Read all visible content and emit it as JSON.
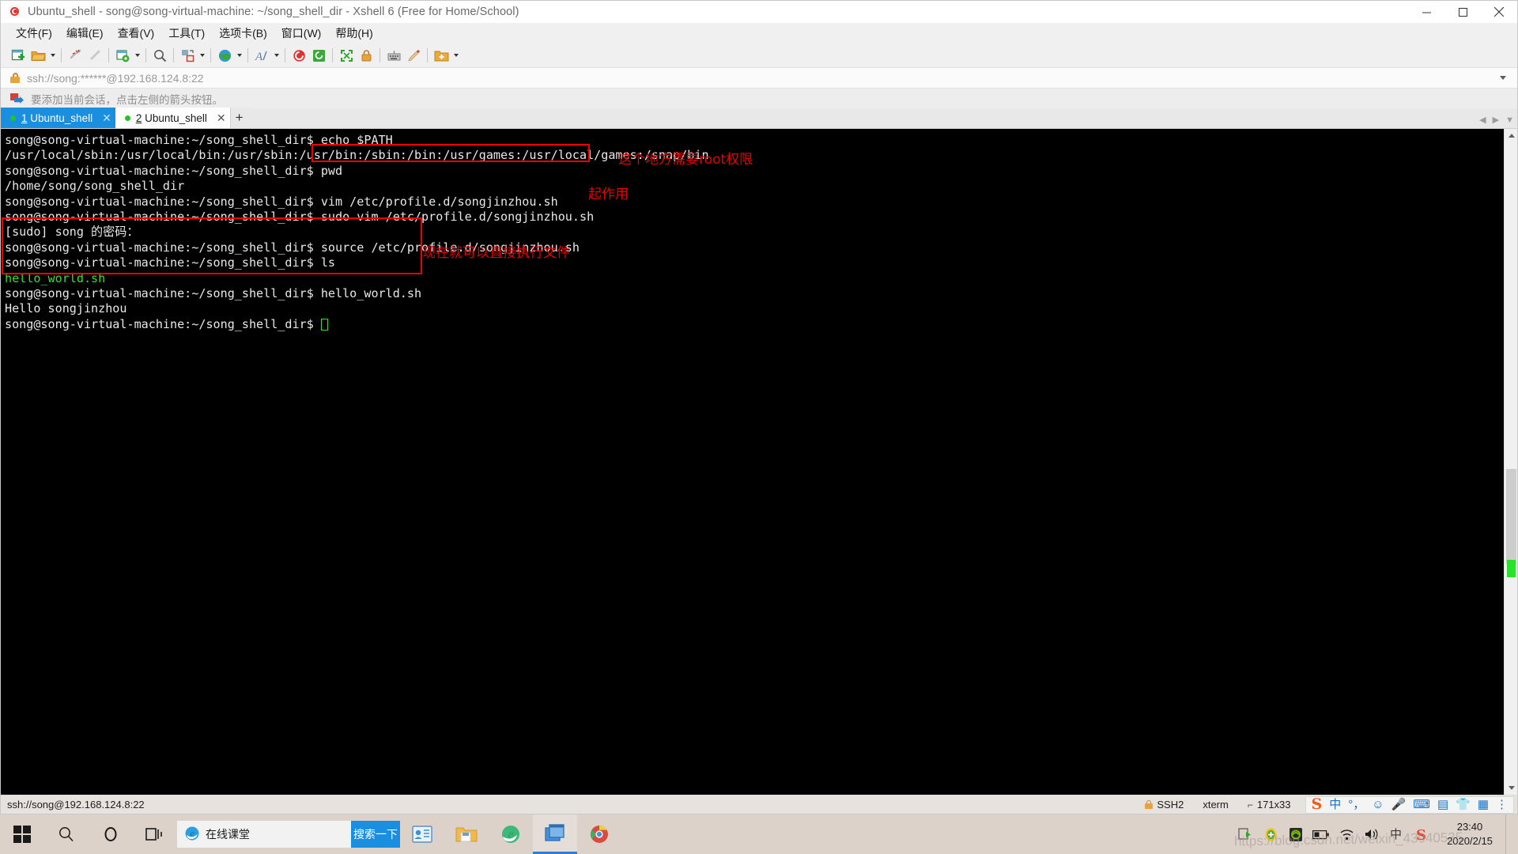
{
  "window": {
    "title": "Ubuntu_shell - song@song-virtual-machine: ~/song_shell_dir - Xshell 6 (Free for Home/School)",
    "app_icon": "xshell-icon",
    "minimize_label": "Minimize",
    "maximize_label": "Maximize",
    "close_label": "Close"
  },
  "menubar": {
    "items": [
      {
        "label": "文件(F)",
        "name": "menu-file"
      },
      {
        "label": "编辑(E)",
        "name": "menu-edit"
      },
      {
        "label": "查看(V)",
        "name": "menu-view"
      },
      {
        "label": "工具(T)",
        "name": "menu-tools"
      },
      {
        "label": "选项卡(B)",
        "name": "menu-tabs"
      },
      {
        "label": "窗口(W)",
        "name": "menu-window"
      },
      {
        "label": "帮助(H)",
        "name": "menu-help"
      }
    ]
  },
  "toolbar": {
    "buttons": [
      {
        "icon": "new-session-icon",
        "caret": false
      },
      {
        "icon": "open-folder-icon",
        "caret": true
      },
      {
        "icon": "disconnect-icon",
        "caret": false
      },
      {
        "icon": "reconnect-link-icon",
        "caret": false
      },
      {
        "icon": "session-properties-icon",
        "caret": true
      },
      {
        "icon": "find-icon",
        "caret": false
      },
      {
        "icon": "file-transfer-icon",
        "caret": true
      },
      {
        "icon": "globe-icon",
        "caret": true
      },
      {
        "icon": "font-icon",
        "caret": true
      },
      {
        "icon": "xshell-red-icon",
        "caret": false
      },
      {
        "icon": "xftp-green-icon",
        "caret": false
      },
      {
        "icon": "fullscreen-icon",
        "caret": false
      },
      {
        "icon": "lock-icon",
        "caret": false
      },
      {
        "icon": "keyboard-icon",
        "caret": false
      },
      {
        "icon": "highlight-pen-icon",
        "caret": false
      },
      {
        "icon": "add-folder-icon",
        "caret": true
      }
    ]
  },
  "urlbar": {
    "icon": "lock-icon",
    "value": "ssh://song:******@192.168.124.8:22",
    "dropdown_icon": "chevron-down-icon"
  },
  "notice": {
    "icon": "add-session-arrow-icon",
    "text": "要添加当前会话，点击左侧的箭头按钮。"
  },
  "tabs": {
    "items": [
      {
        "num": "1",
        "label": " Ubuntu_shell",
        "active": true,
        "close_icon": "close-icon"
      },
      {
        "num": "2",
        "label": " Ubuntu_shell",
        "active": false,
        "close_icon": "close-icon"
      }
    ],
    "new_tab_label": "+",
    "scroll_left_icon": "chevron-left-icon",
    "scroll_right_icon": "chevron-right-icon",
    "menu_icon": "chevron-down-icon"
  },
  "terminal": {
    "prompt": "song@song-virtual-machine:~/song_shell_dir$ ",
    "lines": [
      {
        "type": "plain",
        "text": "song@song-virtual-machine:~/song_shell_dir$ echo $PATH"
      },
      {
        "type": "plain",
        "text": "/usr/local/sbin:/usr/local/bin:/usr/sbin:/usr/bin:/sbin:/bin:/usr/games:/usr/local/games:/snap/bin"
      },
      {
        "type": "plain",
        "text": "song@song-virtual-machine:~/song_shell_dir$ pwd"
      },
      {
        "type": "plain",
        "text": "/home/song/song_shell_dir"
      },
      {
        "type": "plain",
        "text": "song@song-virtual-machine:~/song_shell_dir$ vim /etc/profile.d/songjinzhou.sh"
      },
      {
        "type": "plain",
        "text": "song@song-virtual-machine:~/song_shell_dir$ sudo vim /etc/profile.d/songjinzhou.sh"
      },
      {
        "type": "plain",
        "text": "[sudo] song 的密码："
      },
      {
        "type": "plain",
        "text": "song@song-virtual-machine:~/song_shell_dir$ source /etc/profile.d/songjinzhou.sh"
      },
      {
        "type": "plain",
        "text": "song@song-virtual-machine:~/song_shell_dir$ ls"
      },
      {
        "type": "green",
        "text": "hello_world.sh"
      },
      {
        "type": "plain",
        "text": "song@song-virtual-machine:~/song_shell_dir$ hello_world.sh"
      },
      {
        "type": "plain",
        "text": "Hello songjinzhou"
      },
      {
        "type": "cursor",
        "text": "song@song-virtual-machine:~/song_shell_dir$ "
      }
    ],
    "colors": {
      "background": "#000000",
      "foreground": "#e8e8e8",
      "green": "#2ee02e"
    }
  },
  "annotations": {
    "color": "#e60000",
    "items": [
      {
        "text": "这个地方需要root权限",
        "name": "annotation-root-permission"
      },
      {
        "text": "起作用",
        "name": "annotation-takes-effect"
      },
      {
        "text": "现在就可以直接执行文件",
        "name": "annotation-can-execute-directly"
      }
    ]
  },
  "statusbar": {
    "connection": "ssh://song@192.168.124.8:22",
    "security": "SSH2",
    "terminal_type": "xterm",
    "size_icon": "corner-icon",
    "size": "171x33",
    "ime": {
      "logo": "sogou-logo-icon",
      "lang": "中",
      "punct": "°，",
      "smiley": "smiley-icon",
      "mic": "microphone-icon",
      "keyboard": "keyboard-icon",
      "user": "user-card-icon",
      "shirt": "skin-icon",
      "grid": "toolbox-icon",
      "more": "more-icon"
    }
  },
  "taskbar": {
    "start_icon": "windows-start-icon",
    "search_icon": "search-icon",
    "cortana_icon": "cortana-icon",
    "taskview_icon": "task-view-icon",
    "search_box": {
      "icon": "ie-icon",
      "value": "在线课堂",
      "button_label": "搜索一下"
    },
    "pinned": [
      {
        "icon": "contacts-icon",
        "name": "taskbar-contacts"
      },
      {
        "icon": "file-explorer-icon",
        "name": "taskbar-file-explorer"
      },
      {
        "icon": "edge-icon",
        "name": "taskbar-edge"
      },
      {
        "icon": "xshell-window-icon",
        "name": "taskbar-xshell",
        "active": true
      },
      {
        "icon": "chrome-icon",
        "name": "taskbar-chrome"
      }
    ],
    "tray": [
      {
        "icon": "share-play-icon",
        "name": "tray-share"
      },
      {
        "icon": "green-plus-shield-icon",
        "name": "tray-security"
      },
      {
        "icon": "nvidia-icon",
        "name": "tray-graphics"
      },
      {
        "icon": "battery-icon",
        "name": "tray-battery"
      },
      {
        "icon": "wifi-icon",
        "name": "tray-network"
      },
      {
        "icon": "volume-icon",
        "name": "tray-volume"
      },
      {
        "icon": "ime-cn-icon",
        "name": "tray-ime"
      },
      {
        "icon": "sogou-icon",
        "name": "tray-sogou"
      }
    ],
    "clock": {
      "time": "23:40",
      "date": "2020/2/15"
    },
    "show_desktop_label": "Show desktop"
  },
  "watermark": "https://blog.csdn.net/weixin_43940535"
}
